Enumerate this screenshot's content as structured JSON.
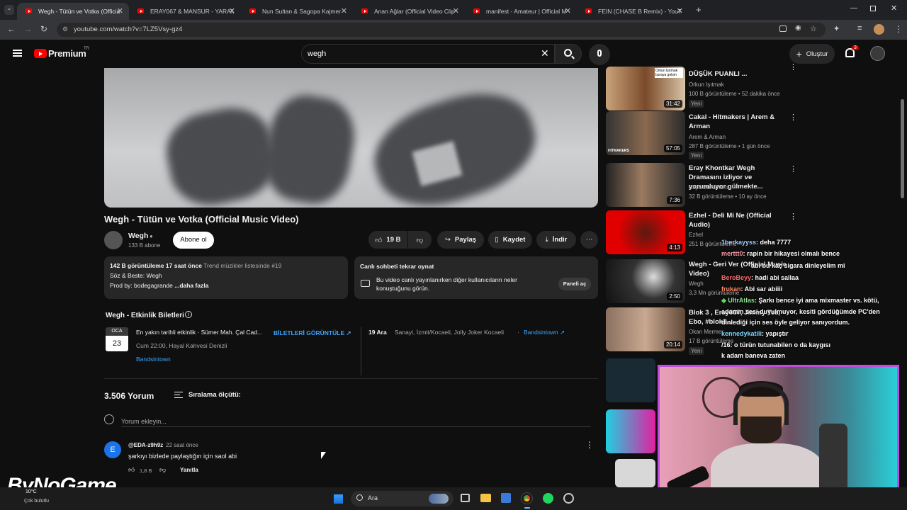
{
  "browser": {
    "tabs": [
      {
        "label": "Wegh - Tütün ve Votka (Officia"
      },
      {
        "label": "ERAY067 & MANSUR - YARAM"
      },
      {
        "label": "Nun Sultan & Sagopa Kajmer"
      },
      {
        "label": "Anan Ağlar (Official Video Clip"
      },
      {
        "label": "manifest - Amateur | Official M"
      },
      {
        "label": "FEIN (CHASE B Remix) - YouTu"
      }
    ],
    "url": "youtube.com/watch?v=7LZ5Vsy-gz4"
  },
  "header": {
    "brand": "Premium",
    "brand_sup": "TR",
    "search_value": "wegh",
    "create_label": "Oluştur",
    "notif_count": "3"
  },
  "video": {
    "title": "Wegh - Tütün ve Votka (Official Music Video)",
    "channel": "Wegh",
    "subs": "133 B abone",
    "subscribe": "Abone ol",
    "likes": "19 B",
    "share": "Paylaş",
    "save": "Kaydet",
    "download": "İndir",
    "desc_views": "142 B görüntüleme",
    "desc_time": "17 saat önce",
    "desc_trend": "Trend müzikler listesinde #19",
    "desc_line2": "Söz & Beste: Wegh",
    "desc_line3": "Prod by: bodegagrande",
    "more": "...daha fazla",
    "chat_title": "Canlı sohbeti tekrar oynat",
    "chat_desc": "Bu video canlı yayınlanırken diğer kullanıcıların neler konuştuğunu görün.",
    "chat_btn": "Paneli aç"
  },
  "events": {
    "title": "Wegh - Etkinlik Biletleri",
    "month": "OCA",
    "day": "23",
    "e1_title": "En yakın tarihli etkinlik · Sümer Mah. Çal Cad...",
    "e1_time": "Cum 22:00, Hayal Kahvesi Denizli",
    "e1_provider": "Bandsintown",
    "tickets": "BİLETLERİ GÖRÜNTÜLE ↗",
    "e2_date": "19 Ara",
    "e2_place": "Sanayi, İzmit/Kocaeli, Jolly Joker Kocaeli",
    "e2_provider": "Bandsintown ↗"
  },
  "comments": {
    "count": "3.506 Yorum",
    "sort": "Sıralama ölçütü:",
    "placeholder": "Yorum ekleyin...",
    "c1_user": "@EDA-z9h9z",
    "c1_time": "22 saat önce",
    "c1_text": "şarkıyı bizlede paylaştığın için saol abi",
    "c1_likes": "1,8 B",
    "c1_reply": "Yanıtla",
    "c1_avatar": "E"
  },
  "sidebar": [
    {
      "title": "DÜŞÜK PUANLI ...",
      "channel": "Orkun Işıtmak",
      "meta": "100 B görüntüleme • 52 dakika önce",
      "badge": "Yeni",
      "dur": "31:42",
      "thumb_text": "Orkun Işıtmak buraya gelsin"
    },
    {
      "title": "Cakal - Hitmakers | Arem & Arman",
      "channel": "Arem & Arman",
      "meta": "287 B görüntüleme • 1 gün önce",
      "badge": "Yeni",
      "dur": "57:05",
      "thumb_text": "HITMAKERS"
    },
    {
      "title": "Eray Khontkar Wegh Dramasını izliyor ve yorumluyor gülmekte...",
      "channel": "Clips But Shorts",
      "meta": "32 B görüntüleme • 10 ay önce",
      "dur": "7:36"
    },
    {
      "title": "Ezhel - Deli Mi Ne (Official Audio)",
      "channel": "Ezhel",
      "meta": "251 B görüntüleme",
      "dur": "4:13"
    },
    {
      "title": "Wegh - Geri Ver (Official Music Video)",
      "channel": "Wegh",
      "meta": "3,3 Mn görüntüleme",
      "dur": "2:50"
    },
    {
      "title": "Blok 3 , Eray067, Jimmy Tea, Ebo, #blok3...",
      "channel": "Okan Mermer",
      "meta": "17 B görüntüleme",
      "badge": "Yeni",
      "dur": "20:14"
    }
  ],
  "chat": [
    {
      "user": "1berkayyss",
      "msg": ": deha 7777",
      "color": "#a9c7ff"
    },
    {
      "user": "merttt0",
      "msg": ": rapin bir hikayesi olmalı bence",
      "color": "#ff9aa8"
    },
    {
      "user": "",
      "msg": "abi bu kaç sigara dinleyelim mi",
      "color": "#ffd36e"
    },
    {
      "user": "BeroBeyy",
      "msg": ": hadi abi sallaa",
      "color": "#ff6b6b"
    },
    {
      "user": "frukan",
      "msg": ": Abi sar abiiii",
      "color": "#ff8c69"
    },
    {
      "user": "UltrAtlas",
      "msg": ": Şarkı bence iyi ama mixmaster vs. kötü,",
      "color": "#8fe38f"
    },
    {
      "user": "",
      "msg": "adamın sesi duyulmuyor, kesiti gördüğümde PC'den",
      "color": "#fff"
    },
    {
      "user": "",
      "msg": "dinlediği için ses öyle geliyor sanıyordum.",
      "color": "#fff"
    },
    {
      "user": "kennedykatili",
      "msg": ": yapıştır",
      "color": "#7fd6ff"
    },
    {
      "user": "/16",
      "msg": ": o türün tutunabilen o da kaygısı",
      "color": "#fff"
    },
    {
      "user": "",
      "msg": "k adam baneva zaten",
      "color": "#fff"
    }
  ],
  "overlay": {
    "logo": "ByNoGame",
    "weather": "10°C",
    "weather_sub": "Çok bulutlu"
  },
  "taskbar": {
    "search": "Ara"
  }
}
